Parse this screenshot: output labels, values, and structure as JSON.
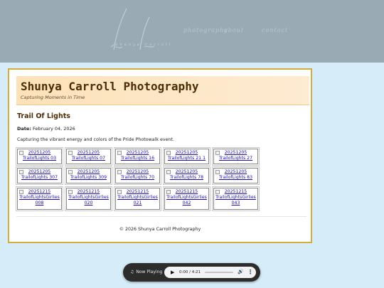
{
  "banner": {
    "signature": "Shunya Carroll",
    "nav_items": [
      "photography",
      "about",
      "contact"
    ]
  },
  "site": {
    "title": "Shunya Carroll Photography",
    "tagline": "Capturing Moments in Time"
  },
  "post": {
    "title": "Trail Of Lights",
    "date_label": "Date:",
    "date_value": "February 04, 2026",
    "description": "Capturing the vibrant energy and colors of the Pride Photowalk event."
  },
  "gallery": {
    "rows": [
      [
        "20251205 TrailofLights 03",
        "20251205 TrailofLights 07",
        "20251205 TrailofLights 16",
        "20251205 TrailofLights 21 1",
        "20251205 TrailofLights 27"
      ],
      [
        "20251205 TrailofLights 307",
        "20251205 TrailofLights 309",
        "20251205 TrailofLights 70",
        "20251205 TrailofLights 78",
        "20251205 TrailofLights 83"
      ],
      [
        "20251215 TrailofLightsGirlies 008",
        "20251215 TrailofLightsGirlies 020",
        "20251215 TrailofLightsGirlies 021",
        "20251215 TrailofLightsGirlies 042",
        "20251215 TrailofLightsGirlies 043"
      ]
    ]
  },
  "footer": {
    "text": "© 2026 Shunya Carroll Photography"
  },
  "player": {
    "now_playing_label": "Now Playing",
    "time_display": "0:00 / 4:21",
    "progress": 0.0,
    "icons": {
      "note": "music-note-icon",
      "play": "play-icon",
      "volume": "volume-icon",
      "more": "more-options-icon"
    }
  },
  "colors": {
    "page_bg": "#d6ecf8",
    "banner_bg": "#9aaab4",
    "card_border": "#d5ad3f",
    "title_color": "#4b2d06",
    "link_color": "#1a0dab"
  }
}
